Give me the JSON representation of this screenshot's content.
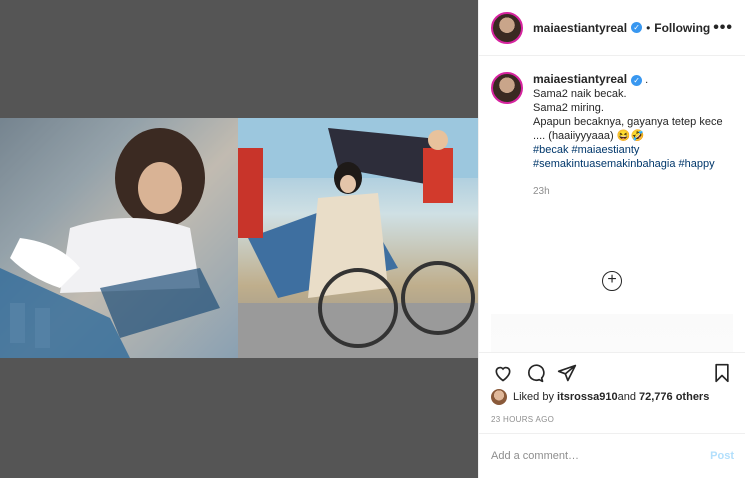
{
  "header": {
    "username": "maiaestiantyreal",
    "separator": "•",
    "follow_status": "Following",
    "more": "•••"
  },
  "caption": {
    "username": "maiaestiantyreal",
    "suffix": ".",
    "lines": [
      "Sama2 naik becak.",
      "Sama2 miring.",
      "Apapun becaknya, gayanya tetep kece",
      ".... (haaiiyyyaaa) 😆🤣"
    ],
    "hashtags_line1": "#becak #maiaestianty",
    "hashtags_line2": "#semakintuasemakinbahagia #happy",
    "time": "23h"
  },
  "load_more": "+",
  "likes": {
    "prefix": "Liked by ",
    "user": "itsrossa910",
    "middle": " and ",
    "count": "72,776 others"
  },
  "time_ago": "23 HOURS AGO",
  "comment": {
    "placeholder": "Add a comment…",
    "post_label": "Post"
  }
}
